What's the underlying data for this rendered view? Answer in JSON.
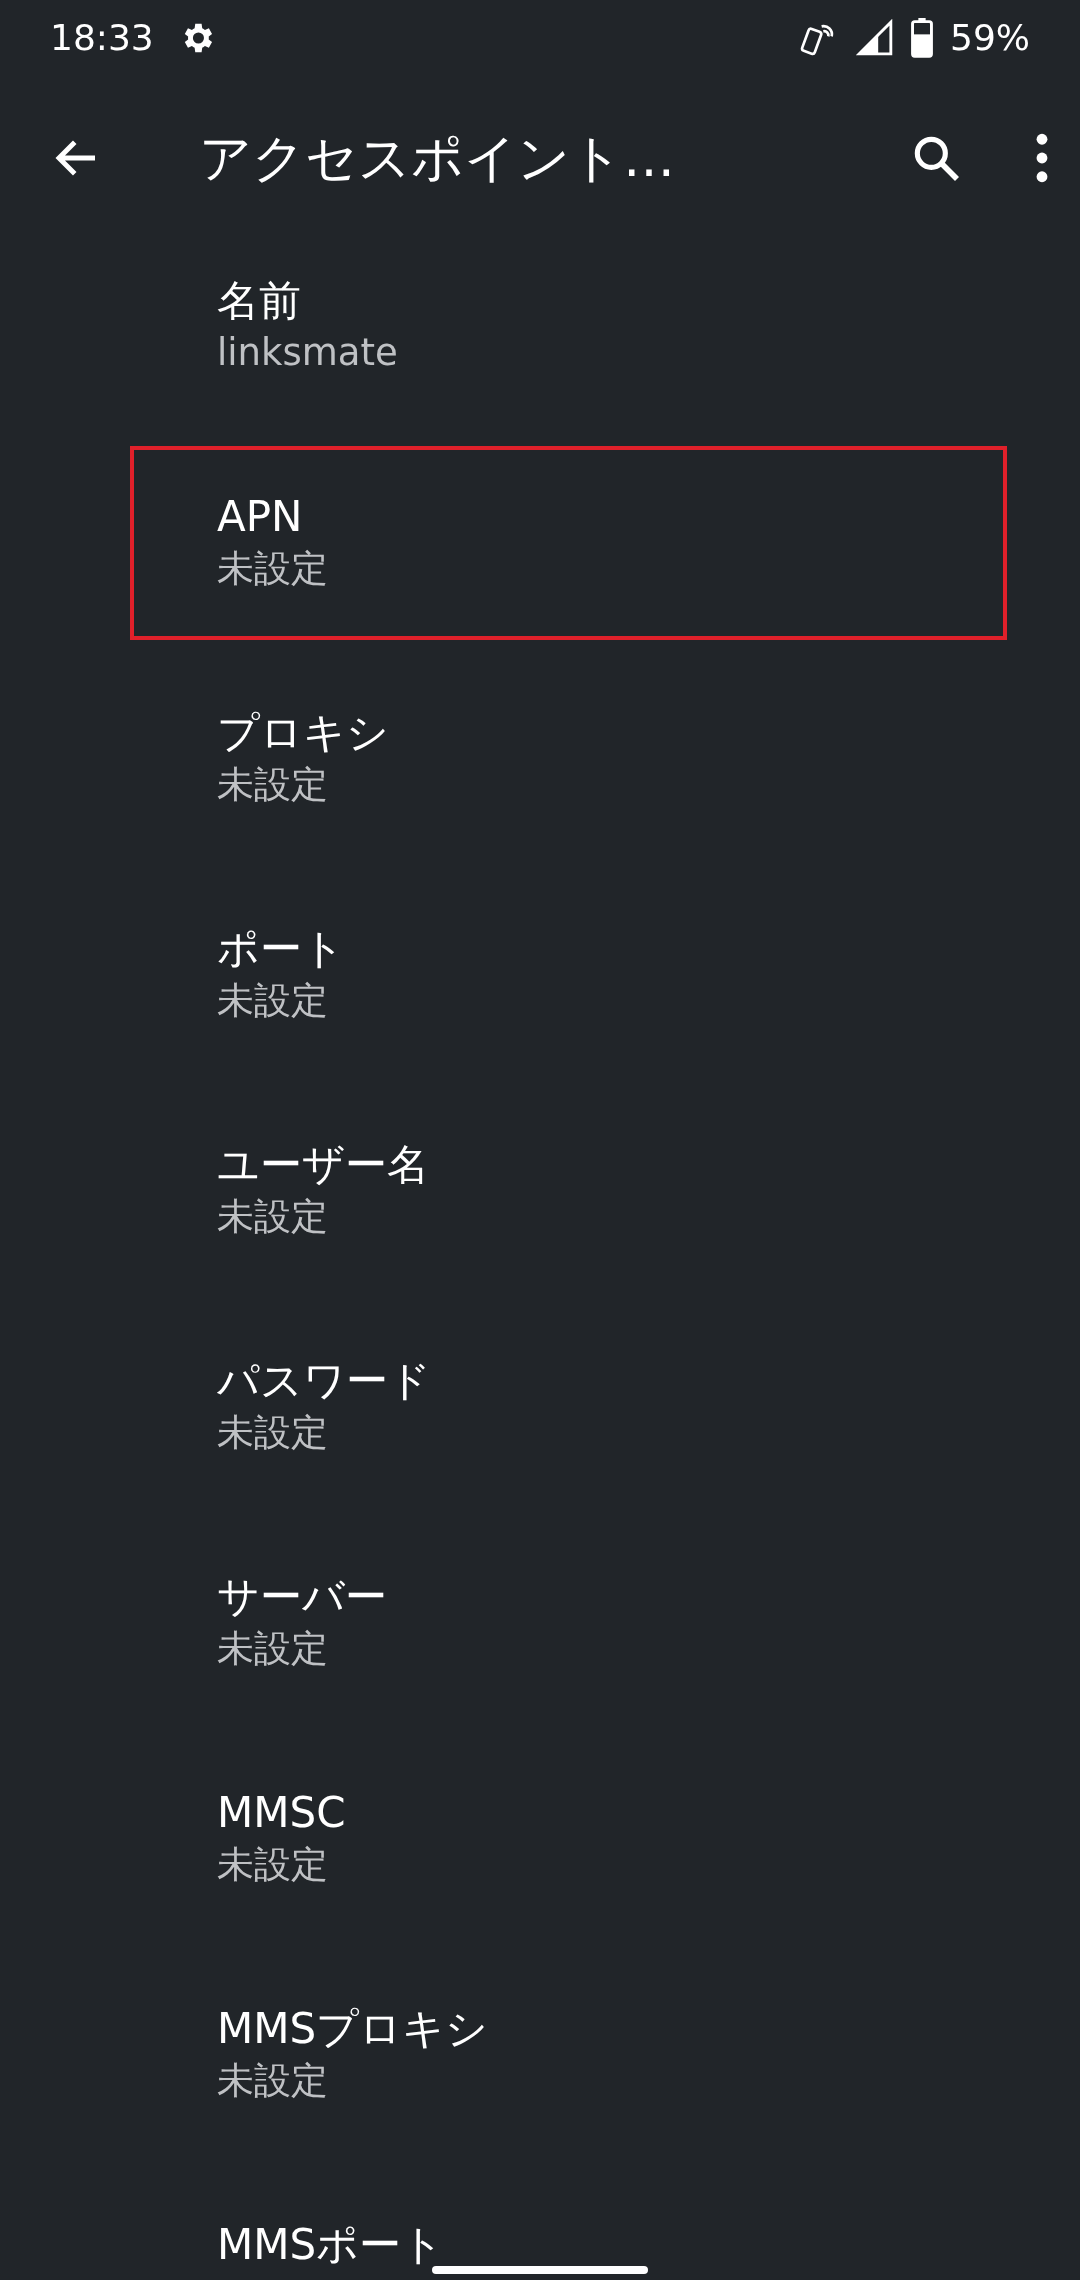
{
  "status_bar": {
    "time": "18:33",
    "battery": "59%"
  },
  "app_bar": {
    "title": "アクセスポイント…"
  },
  "items": [
    {
      "title": "名前",
      "value": "linksmate",
      "highlighted": false
    },
    {
      "title": "APN",
      "value": "未設定",
      "highlighted": true
    },
    {
      "title": "プロキシ",
      "value": "未設定",
      "highlighted": false
    },
    {
      "title": "ポート",
      "value": "未設定",
      "highlighted": false
    },
    {
      "title": "ユーザー名",
      "value": "未設定",
      "highlighted": false
    },
    {
      "title": "パスワード",
      "value": "未設定",
      "highlighted": false
    },
    {
      "title": "サーバー",
      "value": "未設定",
      "highlighted": false
    },
    {
      "title": "MMSC",
      "value": "未設定",
      "highlighted": false
    },
    {
      "title": "MMSプロキシ",
      "value": "未設定",
      "highlighted": false
    },
    {
      "title": "MMSポート",
      "highlighted": false
    }
  ]
}
